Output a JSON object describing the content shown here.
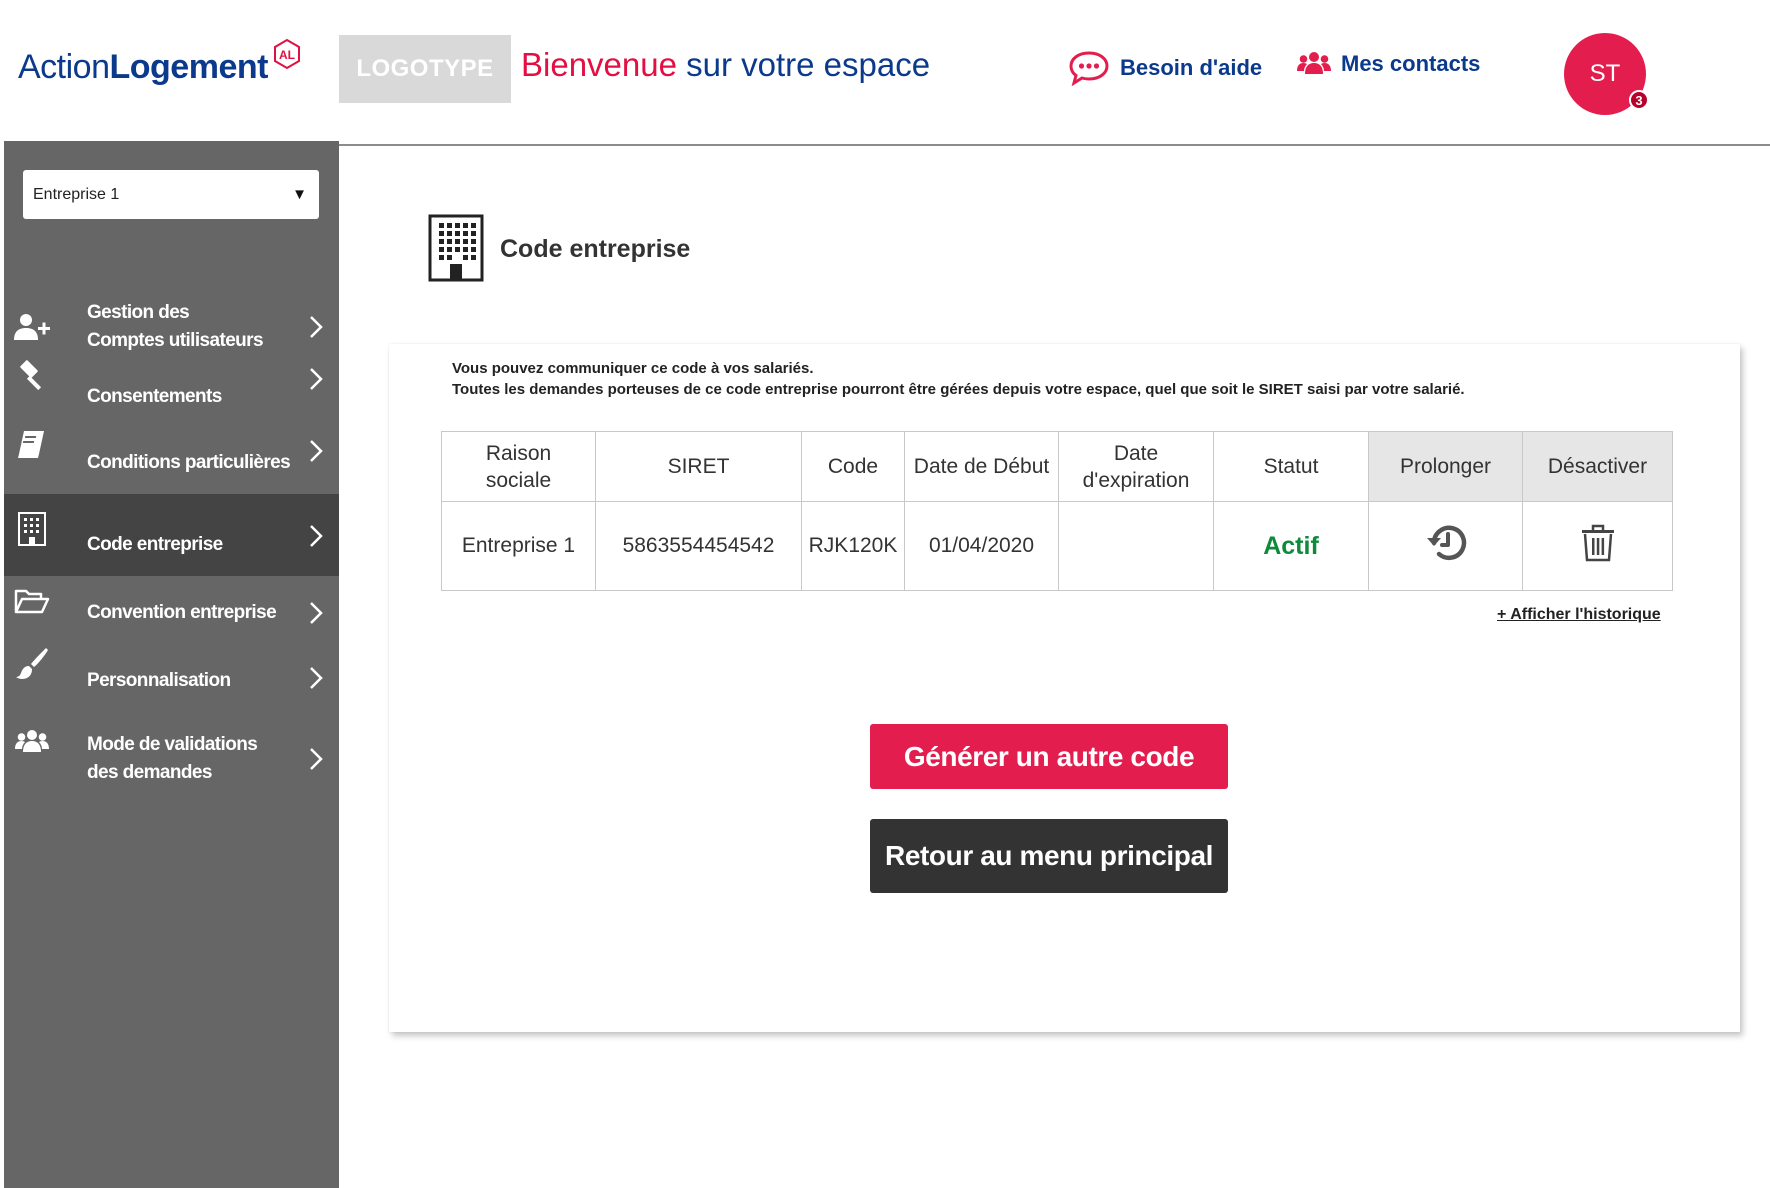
{
  "header": {
    "brand_part1": "Action",
    "brand_part2": "Logement",
    "brand_mark": "AL",
    "logotype": "LOGOTYPE",
    "welcome_part1": "Bienvenue",
    "welcome_part2": "sur votre espace",
    "help_label": "Besoin d'aide",
    "contacts_label": "Mes contacts",
    "avatar_initials": "ST",
    "notification_count": "3"
  },
  "sidebar": {
    "company_select": "Entreprise 1",
    "items": [
      {
        "label": "Gestion des\nComptes utilisateurs",
        "icon": "add-user-icon"
      },
      {
        "label": "Consentements",
        "icon": "gavel-icon"
      },
      {
        "label": "Conditions particulières",
        "icon": "book-icon"
      },
      {
        "label": "Code entreprise",
        "icon": "building-icon",
        "active": true
      },
      {
        "label": "Convention  entreprise",
        "icon": "folder-open-icon"
      },
      {
        "label": "Personnalisation",
        "icon": "paint-brush-icon"
      },
      {
        "label": "Mode de validations\ndes demandes",
        "icon": "users-icon"
      }
    ]
  },
  "main": {
    "title": "Code entreprise",
    "info_line1": "Vous pouvez communiquer ce code à vos salariés.",
    "info_line2": "Toutes les demandes porteuses de ce code entreprise pourront être gérées depuis votre espace, quel que soit le SIRET saisi par votre salarié.",
    "table": {
      "headers": [
        "Raison sociale",
        "SIRET",
        "Code",
        "Date de Début",
        "Date d'expiration",
        "Statut",
        "Prolonger",
        "Désactiver"
      ],
      "rows": [
        {
          "raison_sociale": "Entreprise 1",
          "siret": "5863554454542",
          "code": "RJK120K",
          "date_debut": "01/04/2020",
          "date_expiration": "",
          "statut": "Actif",
          "prolonger_icon": "history-icon",
          "desactiver_icon": "trash-icon"
        }
      ]
    },
    "history_link": "+ Afficher l'historique",
    "generate_button": "Générer un autre code",
    "return_button": "Retour au menu principal"
  },
  "colors": {
    "brand_blue": "#0b3a8c",
    "accent_red": "#e31e4f",
    "sidebar_bg": "#666666",
    "sidebar_active": "#444444",
    "status_green": "#0e8a3c",
    "dark_button": "#333333"
  }
}
